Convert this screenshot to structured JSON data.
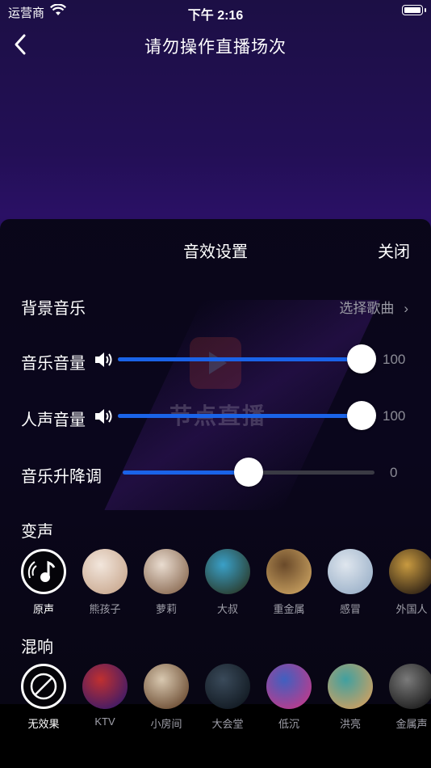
{
  "statusbar": {
    "carrier": "运营商",
    "time": "下午 2:16"
  },
  "nav": {
    "title": "请勿操作直播场次"
  },
  "watermark": {
    "text": "节点直播"
  },
  "sheet": {
    "title": "音效设置",
    "close": "关闭",
    "bgm": {
      "label": "背景音乐",
      "select": "选择歌曲"
    },
    "music_volume": {
      "label": "音乐音量",
      "value": 100,
      "display": "100"
    },
    "vocal_volume": {
      "label": "人声音量",
      "value": 100,
      "display": "100"
    },
    "pitch": {
      "label": "音乐升降调",
      "value": 0,
      "display": "0",
      "min": -12,
      "max": 12
    },
    "voice_change": {
      "label": "变声",
      "items": [
        {
          "name": "原声",
          "selected": true,
          "icon": "microphone-icon"
        },
        {
          "name": "熊孩子",
          "c1": "#f2e6dc",
          "c2": "#c9a88f"
        },
        {
          "name": "萝莉",
          "c1": "#e9dcd0",
          "c2": "#8a6a52"
        },
        {
          "name": "大叔",
          "c1": "#3aa0c8",
          "c2": "#2a3a2a"
        },
        {
          "name": "重金属",
          "c1": "#6a4a2a",
          "c2": "#c8a060"
        },
        {
          "name": "感冒",
          "c1": "#dfe6ee",
          "c2": "#9ab0c8"
        },
        {
          "name": "外国人",
          "c1": "#c89a40",
          "c2": "#2a1e14"
        }
      ]
    },
    "reverb": {
      "label": "混响",
      "items": [
        {
          "name": "无效果",
          "selected": true,
          "icon": "no-effect-icon"
        },
        {
          "name": "KTV",
          "c1": "#c03030",
          "c2": "#3a1a6a"
        },
        {
          "name": "小房间",
          "c1": "#d8c8b0",
          "c2": "#6a4a30"
        },
        {
          "name": "大会堂",
          "c1": "#3a4a5a",
          "c2": "#101820"
        },
        {
          "name": "低沉",
          "c1": "#4060c0",
          "c2": "#c03a8a"
        },
        {
          "name": "洪亮",
          "c1": "#40a0a0",
          "c2": "#d0a060"
        },
        {
          "name": "金属声",
          "c1": "#7a7a7a",
          "c2": "#1a1a1a"
        }
      ]
    }
  }
}
